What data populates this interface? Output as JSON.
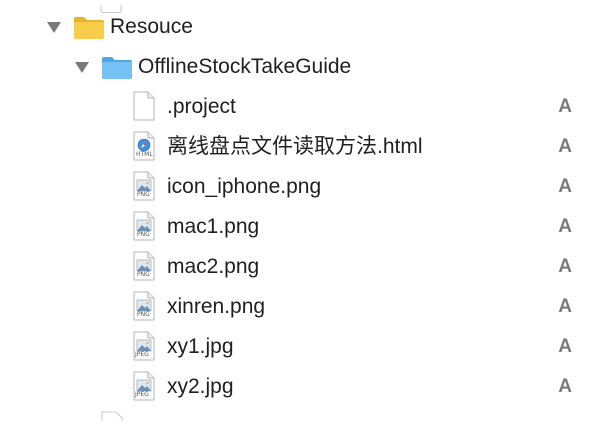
{
  "tree": {
    "folder_root": {
      "label": "Resouce"
    },
    "folder_sub": {
      "label": "OfflineStockTakeGuide"
    },
    "files": [
      {
        "label": ".project",
        "type": "plain",
        "badge": "",
        "status": "A"
      },
      {
        "label": "离线盘点文件读取方法.html",
        "type": "html",
        "badge": "HTML",
        "status": "A"
      },
      {
        "label": "icon_iphone.png",
        "type": "image",
        "badge": "PNG",
        "status": "A"
      },
      {
        "label": "mac1.png",
        "type": "image",
        "badge": "PNG",
        "status": "A"
      },
      {
        "label": "mac2.png",
        "type": "image",
        "badge": "PNG",
        "status": "A"
      },
      {
        "label": "xinren.png",
        "type": "image",
        "badge": "PNG",
        "status": "A"
      },
      {
        "label": "xy1.jpg",
        "type": "image",
        "badge": "JPEG",
        "status": "A"
      },
      {
        "label": "xy2.jpg",
        "type": "image",
        "badge": "JPEG",
        "status": "A"
      }
    ]
  },
  "colors": {
    "folder_yellow": "#f5c842",
    "folder_blue": "#6cbbf0",
    "status_gray": "#7b7b7b"
  }
}
